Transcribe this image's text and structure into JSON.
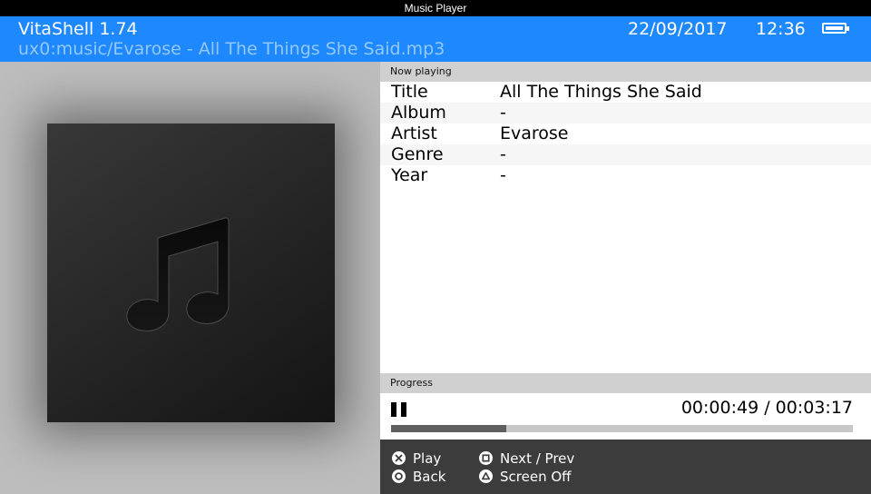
{
  "window": {
    "title": "Music Player"
  },
  "header": {
    "app_name": "VitaShell 1.74",
    "file_path": "ux0:music/Evarose - All The Things She Said.mp3",
    "date": "22/09/2017",
    "time": "12:36",
    "battery_icon": "battery-full-icon"
  },
  "album_art": {
    "icon": "music-note-icon"
  },
  "now_playing": {
    "header": "Now playing",
    "fields": [
      {
        "label": "Title",
        "value": "All The Things She Said"
      },
      {
        "label": "Album",
        "value": "-"
      },
      {
        "label": "Artist",
        "value": "Evarose"
      },
      {
        "label": "Genre",
        "value": "-"
      },
      {
        "label": "Year",
        "value": "-"
      }
    ]
  },
  "progress": {
    "header": "Progress",
    "state_icon": "pause-icon",
    "elapsed": "00:00:49",
    "total": "00:03:17",
    "time_display": "00:00:49 / 00:03:17",
    "fraction": 0.25
  },
  "controls": [
    {
      "icon": "cross-button-icon",
      "label": "Play"
    },
    {
      "icon": "circle-button-icon",
      "label": "Back"
    },
    {
      "icon": "square-button-icon",
      "label": "Next / Prev"
    },
    {
      "icon": "triangle-button-icon",
      "label": "Screen Off"
    }
  ],
  "colors": {
    "accent": "#1e88ff",
    "path_text": "#93c8ff",
    "controls_bg": "#3c3c3c"
  }
}
